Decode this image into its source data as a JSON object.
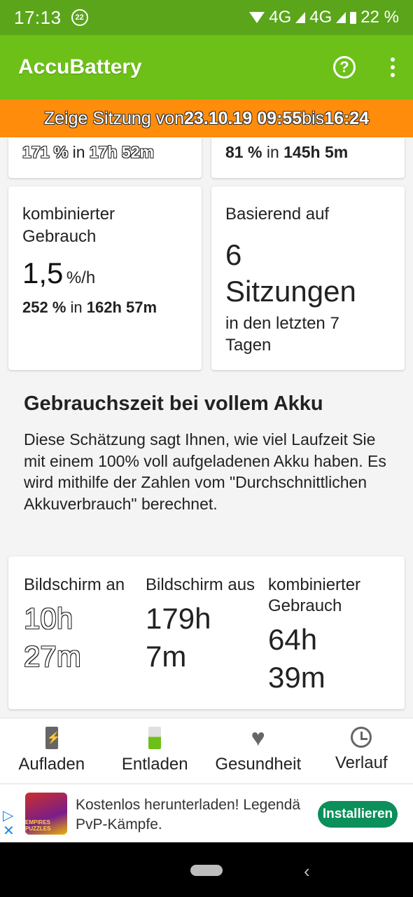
{
  "status_bar": {
    "time": "17:13",
    "notification_badge": "22",
    "network1": "4G",
    "network2": "4G",
    "battery": "22 %"
  },
  "app_bar": {
    "title": "AccuBattery",
    "help_icon": "help-circle-icon",
    "more_icon": "more-vert-icon"
  },
  "session_banner": {
    "prefix": "Zeige Sitzung von ",
    "start": "23.10.19 09:55",
    "middle": " bis ",
    "end": "16:24"
  },
  "partial_cards": {
    "left": {
      "value": "171 %",
      "in": " in ",
      "duration": "17h 52m"
    },
    "right": {
      "value": "81 %",
      "in": " in ",
      "duration": "145h 5m"
    }
  },
  "combined_card": {
    "label": "kombinierter Gebrauch",
    "rate": "1,5",
    "unit": "%/h",
    "value": "252 %",
    "in": " in ",
    "duration": "162h 57m"
  },
  "based_on_card": {
    "label": "Basierend auf",
    "count": "6",
    "sessions": "Sitzungen",
    "period": "in den letzten 7 Tagen"
  },
  "full_battery_section": {
    "title": "Gebrauchszeit bei vollem Akku",
    "description": "Diese Schätzung sagt Ihnen, wie viel Laufzeit Sie mit einem 100% voll aufgeladenen Akku haben. Es wird mithilfe der Zahlen vom \"Durchschnittlichen Akkuverbrauch\" berechnet."
  },
  "runtime_card": {
    "screen_on": {
      "label": "Bildschirm an",
      "line1": "10h",
      "line2": "27m"
    },
    "screen_off": {
      "label": "Bildschirm aus",
      "line1": "179h",
      "line2": "7m"
    },
    "combined": {
      "label": "kombinierter Gebrauch",
      "line1": "64h",
      "line2": "39m"
    }
  },
  "bottom_nav": [
    {
      "label": "Aufladen",
      "icon": "charging-battery-icon"
    },
    {
      "label": "Entladen",
      "icon": "battery-icon"
    },
    {
      "label": "Gesundheit",
      "icon": "heart-icon"
    },
    {
      "label": "Verlauf",
      "icon": "history-icon"
    }
  ],
  "ad": {
    "text": "Kostenlos herunterladen! Legendä PvP-Kämpfe.",
    "thumb_text": "EMPIRES PUZZLES",
    "button": "Installieren"
  },
  "colors": {
    "app_bar": "#6cc017",
    "status_bar": "#5aa51a",
    "banner": "#ff8c0a",
    "install": "#0b8f5b"
  }
}
